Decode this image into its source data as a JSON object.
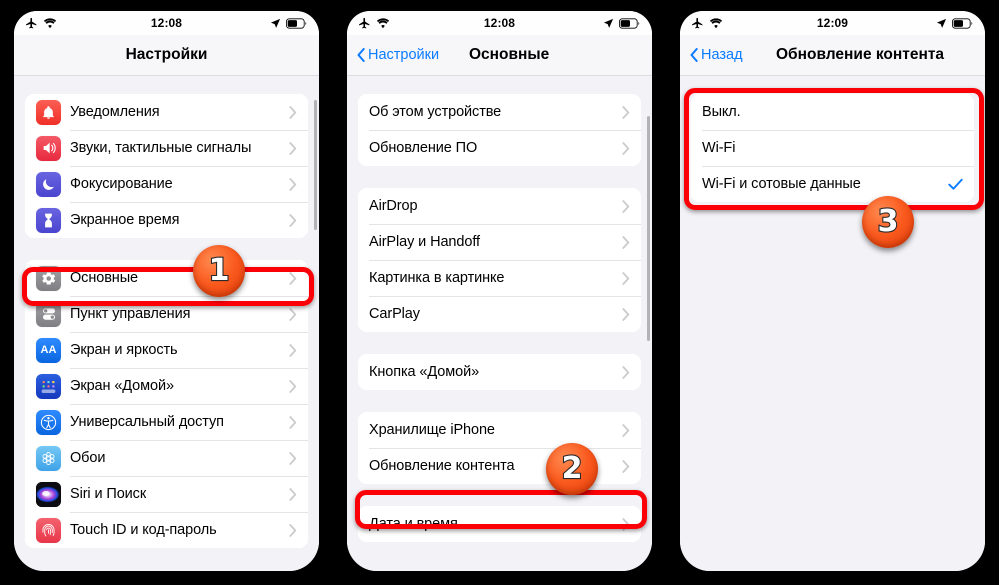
{
  "meta": {
    "accent_blue": "#0a7cff",
    "highlight_red": "#fb0007",
    "badge_orange": "#fa5a1e",
    "screen_bg": "#f2f2f7"
  },
  "panels": [
    {
      "id": "settings-root",
      "status": {
        "time": "12:08",
        "airplane": "airplane-icon",
        "wifi": "wifi-icon",
        "location": "location-arrow-icon",
        "battery": "battery-icon"
      },
      "nav": {
        "title": "Настройки",
        "back_label": null
      },
      "groups": [
        {
          "rows": [
            {
              "label": "Уведомления",
              "icon": "bell-icon",
              "icon_bg": "#f5453c",
              "accessory": "chevron"
            },
            {
              "label": "Звуки, тактильные сигналы",
              "icon": "speaker-icon",
              "icon_bg": "#ef4352",
              "accessory": "chevron"
            },
            {
              "label": "Фокусирование",
              "icon": "moon-icon",
              "icon_bg": "#5753d8",
              "accessory": "chevron"
            },
            {
              "label": "Экранное время",
              "icon": "hourglass-icon",
              "icon_bg": "#5753d8",
              "accessory": "chevron"
            }
          ]
        },
        {
          "rows": [
            {
              "label": "Основные",
              "icon": "gear-icon",
              "icon_bg": "#8e8e93",
              "accessory": "chevron"
            },
            {
              "label": "Пункт управления",
              "icon": "toggles-icon",
              "icon_bg": "#8e8e93",
              "accessory": "chevron"
            },
            {
              "label": "Экран и яркость",
              "icon": "aa-icon",
              "icon_bg": "#1b76ef",
              "accessory": "chevron"
            },
            {
              "label": "Экран «Домой»",
              "icon": "home-grid-icon",
              "icon_bg": "#1b4fd8",
              "accessory": "chevron"
            },
            {
              "label": "Универсальный доступ",
              "icon": "accessibility-icon",
              "icon_bg": "#1b76ef",
              "accessory": "chevron"
            },
            {
              "label": "Обои",
              "icon": "wallpaper-icon",
              "icon_bg": "#4eb3ef",
              "accessory": "chevron"
            },
            {
              "label": "Siri и Поиск",
              "icon": "siri-icon",
              "icon_bg": "#1c1c1e",
              "accessory": "chevron"
            },
            {
              "label": "Touch ID и код-пароль",
              "icon": "fingerprint-icon",
              "icon_bg": "#ef4352",
              "accessory": "chevron"
            }
          ]
        }
      ],
      "annotation": {
        "number": "1",
        "target_label": "Основные"
      }
    },
    {
      "id": "general",
      "status": {
        "time": "12:08",
        "airplane": "airplane-icon",
        "wifi": "wifi-icon",
        "location": "location-arrow-icon",
        "battery": "battery-icon"
      },
      "nav": {
        "title": "Основные",
        "back_label": "Настройки"
      },
      "groups": [
        {
          "rows": [
            {
              "label": "Об этом устройстве",
              "accessory": "chevron"
            },
            {
              "label": "Обновление ПО",
              "accessory": "chevron"
            }
          ]
        },
        {
          "rows": [
            {
              "label": "AirDrop",
              "accessory": "chevron"
            },
            {
              "label": "AirPlay и Handoff",
              "accessory": "chevron"
            },
            {
              "label": "Картинка в картинке",
              "accessory": "chevron"
            },
            {
              "label": "CarPlay",
              "accessory": "chevron"
            }
          ]
        },
        {
          "rows": [
            {
              "label": "Кнопка «Домой»",
              "accessory": "chevron"
            }
          ]
        },
        {
          "rows": [
            {
              "label": "Хранилище iPhone",
              "accessory": "chevron"
            },
            {
              "label": "Обновление контента",
              "accessory": "chevron"
            }
          ]
        },
        {
          "rows": [
            {
              "label": "Дата и время",
              "accessory": "chevron"
            }
          ]
        }
      ],
      "annotation": {
        "number": "2",
        "target_label": "Обновление контента"
      }
    },
    {
      "id": "background-refresh",
      "status": {
        "time": "12:09",
        "airplane": "airplane-icon",
        "wifi": "wifi-icon",
        "location": "location-arrow-icon",
        "battery": "battery-icon"
      },
      "nav": {
        "title": "Обновление контента",
        "back_label": "Назад"
      },
      "groups": [
        {
          "rows": [
            {
              "label": "Выкл.",
              "accessory": "none"
            },
            {
              "label": "Wi-Fi",
              "accessory": "none"
            },
            {
              "label": "Wi-Fi и сотовые данные",
              "accessory": "check"
            }
          ]
        }
      ],
      "annotation": {
        "number": "3",
        "target_label": "Wi-Fi и сотовые данные"
      }
    }
  ]
}
